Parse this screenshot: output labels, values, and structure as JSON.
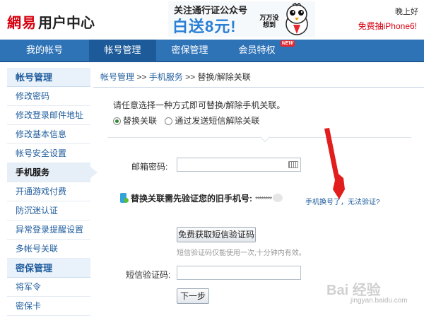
{
  "header": {
    "brand": "網易",
    "title": "用户中心",
    "banner_line1": "关注通行证公众号",
    "banner_line2": "白送8元!",
    "banner_line3": "万万没想到",
    "greeting": "晚上好",
    "promo_link": "免费抽iPhone6!"
  },
  "nav": {
    "items": [
      {
        "label": "我的帐号",
        "active": false
      },
      {
        "label": "帐号管理",
        "active": true
      },
      {
        "label": "密保管理",
        "active": false
      },
      {
        "label": "会员特权",
        "active": false,
        "badge": "NEW"
      }
    ]
  },
  "sidebar": {
    "section1": "帐号管理",
    "items1": [
      "修改密码",
      "修改登录邮件地址",
      "修改基本信息",
      "帐号安全设置",
      "手机服务",
      "开通游戏付费",
      "防沉迷认证",
      "异常登录提醒设置",
      "多帐号关联"
    ],
    "active_item": "手机服务",
    "section2": "密保管理",
    "items2": [
      "将军令",
      "密保卡"
    ]
  },
  "main": {
    "breadcrumb": [
      "帐号管理",
      "手机服务",
      "替换/解除关联"
    ],
    "breadcrumb_sep": ">>",
    "intro": "请任意选择一种方式即可替换/解除手机关联。",
    "radio_options": [
      {
        "label": "替换关联",
        "checked": true
      },
      {
        "label": "通过发送短信解除关联",
        "checked": false
      }
    ],
    "email_password_label": "邮箱密码:",
    "email_password_value": "",
    "verify_text": "替换关联需先验证您的旧手机号:",
    "masked_phone": "********",
    "cannot_verify_link": "手机换号了，无法验证?",
    "get_code_button": "免费获取短信验证码",
    "code_hint": "短信验证码仅能使用一次,十分钟内有效。",
    "sms_code_label": "短信验证码:",
    "sms_code_value": "",
    "next_button": "下一步"
  },
  "watermark": {
    "text": "Bai 经验",
    "url": "jingyan.baidu.com"
  },
  "colors": {
    "nav_bg": "#2f73b7",
    "nav_active": "#1d5a99",
    "link": "#1f5c9c",
    "brand_red": "#d7000f",
    "arrow_red": "#e11d1d"
  }
}
